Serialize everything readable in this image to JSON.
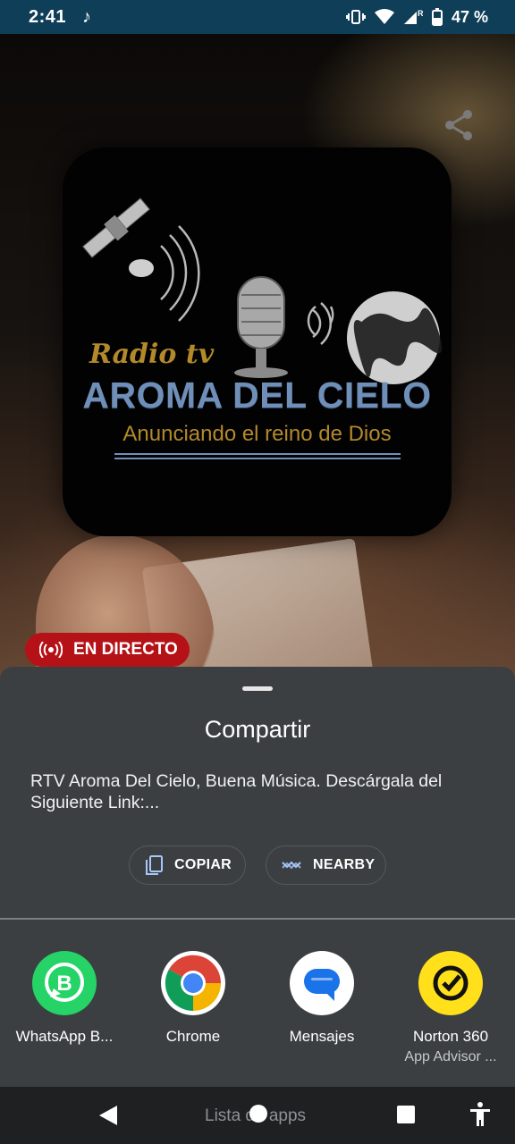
{
  "status_bar": {
    "time": "2:41",
    "battery": "47 %",
    "roaming_indicator": "R"
  },
  "player": {
    "logo": {
      "radio_tv": "Radio tv",
      "title": "AROMA DEL CIELO",
      "subtitle": "Anunciando el reino de Dios"
    },
    "live_badge": "EN DIRECTO"
  },
  "share_sheet": {
    "title": "Compartir",
    "message": "RTV Aroma Del Cielo, Buena Música. Descárgala del Siguiente Link:...",
    "copy_label": "COPIAR",
    "nearby_label": "NEARBY",
    "apps": [
      {
        "label": "WhatsApp B...",
        "sub": "",
        "icon": "whatsapp-business-icon"
      },
      {
        "label": "Chrome",
        "sub": "",
        "icon": "chrome-icon"
      },
      {
        "label": "Mensajes",
        "sub": "",
        "icon": "messages-icon"
      },
      {
        "label": "Norton 360",
        "sub": "App Advisor ...",
        "icon": "norton-icon"
      }
    ]
  },
  "nav_bar": {
    "label": "Lista de apps"
  },
  "colors": {
    "status_bar": "#0f3e58",
    "sheet": "#3c3f42",
    "live_badge": "#b51218",
    "whatsapp": "#25d366",
    "norton": "#ffe01b"
  }
}
